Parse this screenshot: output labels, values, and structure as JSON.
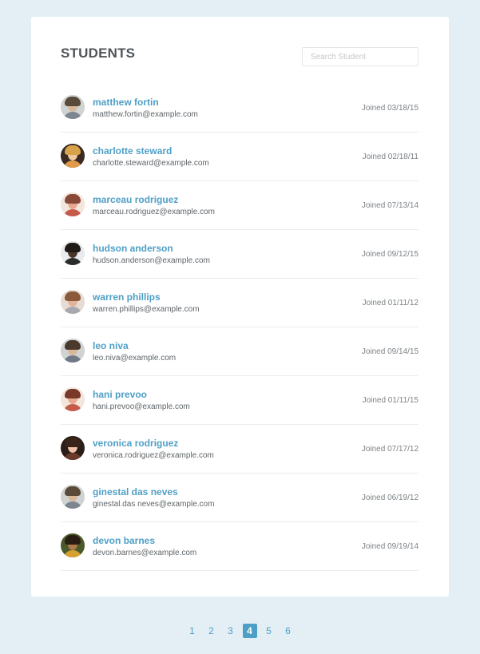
{
  "header": {
    "title": "STUDENTS",
    "search_placeholder": "Search Student"
  },
  "students": [
    {
      "name": "matthew fortin",
      "email": "matthew.fortin@example.com",
      "joined": "Joined 03/18/15",
      "avatar": {
        "bg": "#cfd3d2",
        "hair": "#5a4a3a",
        "skin": "#d9b89a",
        "shirt": "#7c8590"
      }
    },
    {
      "name": "charlotte steward",
      "email": "charlotte.steward@example.com",
      "joined": "Joined 02/18/11",
      "avatar": {
        "bg": "#3a2b22",
        "hair": "#d8a24a",
        "skin": "#f0c8a0",
        "shirt": "#e09a4a"
      }
    },
    {
      "name": "marceau rodriguez",
      "email": "marceau.rodriguez@example.com",
      "joined": "Joined 07/13/14",
      "avatar": {
        "bg": "#f3e6dc",
        "hair": "#8a4a3a",
        "skin": "#e8a890",
        "shirt": "#c55a4a"
      }
    },
    {
      "name": "hudson anderson",
      "email": "hudson.anderson@example.com",
      "joined": "Joined 09/12/15",
      "avatar": {
        "bg": "#e9ecee",
        "hair": "#1f1a17",
        "skin": "#4a3428",
        "shirt": "#2c2c2c"
      }
    },
    {
      "name": "warren phillips",
      "email": "warren.phillips@example.com",
      "joined": "Joined 01/11/12",
      "avatar": {
        "bg": "#e6dcd4",
        "hair": "#8a5a3a",
        "skin": "#e0b49a",
        "shirt": "#a8a8b0"
      }
    },
    {
      "name": "leo niva",
      "email": "leo.niva@example.com",
      "joined": "Joined 09/14/15",
      "avatar": {
        "bg": "#cfd3d2",
        "hair": "#4a3a2e",
        "skin": "#d9b89a",
        "shirt": "#6f7a86"
      }
    },
    {
      "name": "hani prevoo",
      "email": "hani.prevoo@example.com",
      "joined": "Joined 01/11/15",
      "avatar": {
        "bg": "#f3e6dc",
        "hair": "#7a3a2a",
        "skin": "#e8a890",
        "shirt": "#c55a4a"
      }
    },
    {
      "name": "veronica rodriguez",
      "email": "veronica.rodriguez@example.com",
      "joined": "Joined 07/17/12",
      "avatar": {
        "bg": "#2a1e18",
        "hair": "#3a241a",
        "skin": "#f0c2a8",
        "shirt": "#6a3a2a"
      }
    },
    {
      "name": "ginestal das neves",
      "email": "ginestal.das neves@example.com",
      "joined": "Joined 06/19/12",
      "avatar": {
        "bg": "#cfd3d2",
        "hair": "#5a4a3a",
        "skin": "#d9b89a",
        "shirt": "#7c8590"
      }
    },
    {
      "name": "devon barnes",
      "email": "devon.barnes@example.com",
      "joined": "Joined 09/19/14",
      "avatar": {
        "bg": "#4a5a2a",
        "hair": "#2a1e14",
        "skin": "#b07a4a",
        "shirt": "#d8a030"
      }
    }
  ],
  "pagination": {
    "pages": [
      "1",
      "2",
      "3",
      "4",
      "5",
      "6"
    ],
    "active": "4"
  },
  "colors": {
    "background": "#e3eff5",
    "accent": "#4e9fc6",
    "title": "#4f5458"
  }
}
